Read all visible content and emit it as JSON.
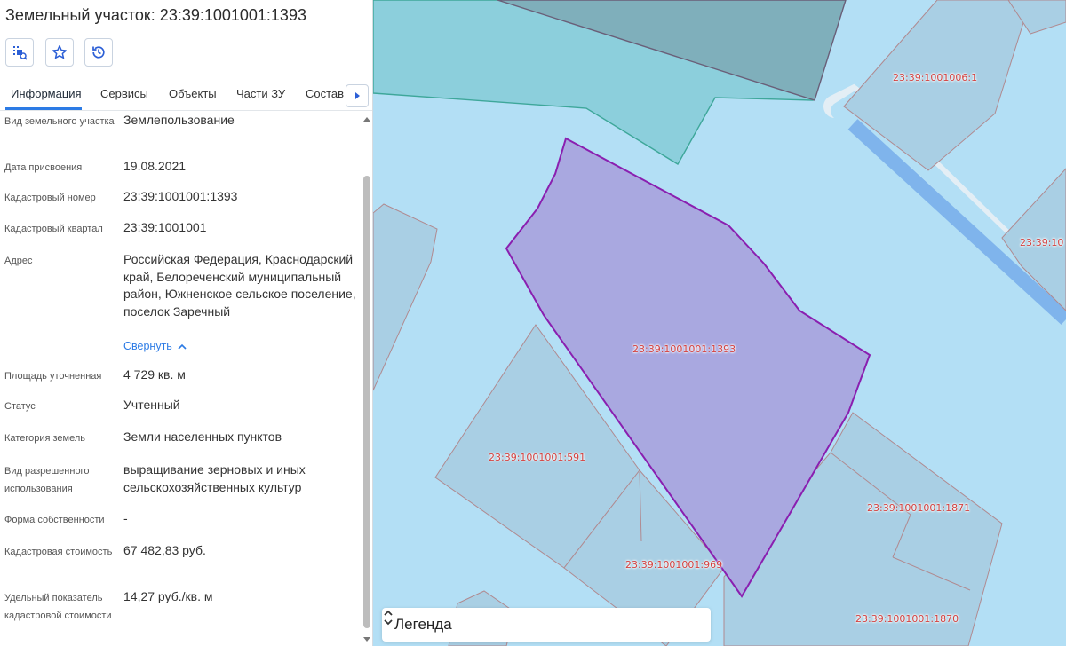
{
  "header": {
    "title": "Земельный участок: 23:39:1001001:1393"
  },
  "toolbar": {
    "buttons": [
      {
        "name": "select-area-button",
        "icon": "select-zoom-icon"
      },
      {
        "name": "favorite-button",
        "icon": "star-icon"
      },
      {
        "name": "history-button",
        "icon": "history-icon"
      }
    ]
  },
  "tabs": [
    {
      "label": "Информация",
      "active": true
    },
    {
      "label": "Сервисы"
    },
    {
      "label": "Объекты"
    },
    {
      "label": "Части ЗУ"
    },
    {
      "label": "Состав"
    }
  ],
  "info": [
    {
      "label": "Вид земельного участка",
      "value": "Землепользование"
    },
    {
      "label": "Дата присвоения",
      "value": "19.08.2021"
    },
    {
      "label": "Кадастровый номер",
      "value": "23:39:1001001:1393"
    },
    {
      "label": "Кадастровый квартал",
      "value": "23:39:1001001"
    },
    {
      "label": "Адрес",
      "value": "Российская Федерация, Краснодарский край, Белореченский муниципальный район, Южненское сельское поселение, поселок Заречный"
    },
    {
      "label": "Площадь уточненная",
      "value": "4 729 кв. м"
    },
    {
      "label": "Статус",
      "value": "Учтенный"
    },
    {
      "label": "Категория земель",
      "value": "Земли населенных пунктов"
    },
    {
      "label": "Вид разрешенного использования",
      "value": "выращивание зерновых и иных сельскохозяйственных культур"
    },
    {
      "label": "Форма собственности",
      "value": "-"
    },
    {
      "label": "Кадастровая стоимость",
      "value": "67 482,83 руб."
    },
    {
      "label": "Удельный показатель кадастровой стоимости",
      "value": "14,27 руб./кв. м"
    }
  ],
  "collapse_link": "Свернуть",
  "map": {
    "parcel_labels": [
      "23:39:1001006:1",
      "23:39:1001001:1393",
      "23:39:1001001:591",
      "23:39:1001001:1871",
      "23:39:1001001:969",
      "23:39:1001001:1870",
      "23:39:10"
    ],
    "colors": {
      "background": "#b3dff5",
      "selected_fill": "#a9a8e0",
      "selected_stroke": "#8a1fb0",
      "parcel_label": "#d4413f"
    }
  },
  "legend": {
    "title": "Легенда"
  }
}
